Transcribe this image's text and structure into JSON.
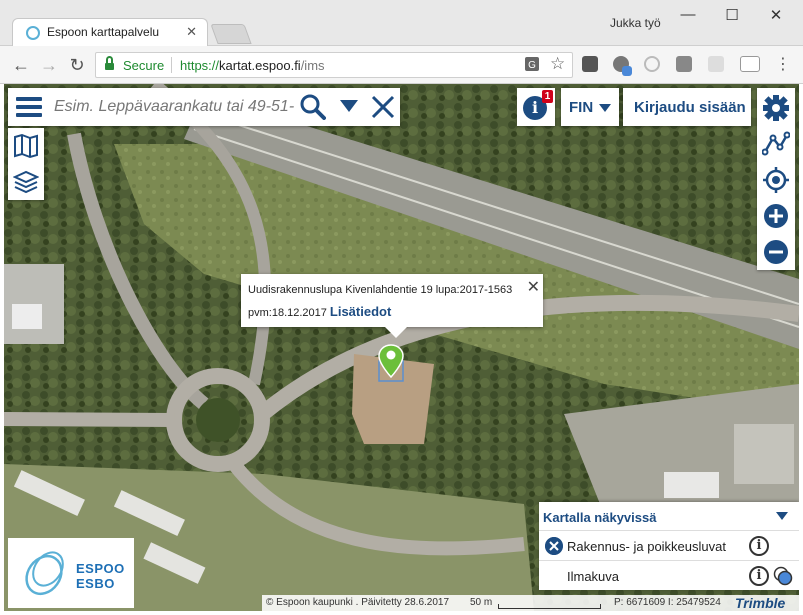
{
  "browser": {
    "tab_title": "Espoon karttapalvelu",
    "profile_name": "Jukka työ",
    "secure_label": "Secure",
    "url_scheme": "https://",
    "url_host": "kartat.espoo.fi",
    "url_path": "/ims"
  },
  "search": {
    "placeholder": "Esim. Leppävaarankatu tai 49-51-"
  },
  "header": {
    "info_badge_count": "1",
    "info_glyph": "i",
    "language": "FIN",
    "login_label": "Kirjaudu sisään"
  },
  "popup": {
    "line1": "Uudisrakennuslupa Kivenlahdentie 19 lupa:2017-1563",
    "line2": "pvm:18.12.2017",
    "link": "Lisätiedot",
    "close_glyph": "✕"
  },
  "logo": {
    "line1": "ESPOO",
    "line2": "ESBO"
  },
  "layers_panel": {
    "title": "Kartalla näkyvissä",
    "items": [
      {
        "name": "Rakennus- ja poikkeusluvat",
        "removable": true
      },
      {
        "name": "Ilmakuva",
        "removable": false
      }
    ]
  },
  "statusbar": {
    "copyright": "© Espoon kaupunki . Päivitetty 28.6.2017",
    "scale": "50 m",
    "coordinates": "P: 6671609 I: 25479524",
    "provider": "Trimble"
  },
  "icons": {
    "menu": "hamburger-icon",
    "search": "search-icon",
    "dropdown": "chevron-down-icon",
    "clear": "close-icon",
    "map_view": "map-icon",
    "layers": "layers-icon",
    "settings": "gear-icon",
    "measure": "measure-icon",
    "locate": "locate-icon",
    "zoom_in": "zoom-in-icon",
    "zoom_out": "zoom-out-icon",
    "marker": "map-marker-icon"
  },
  "colors": {
    "brand_blue": "#1d4c82",
    "logo_blue": "#1d6fb5",
    "marker_green": "#6cbf3a",
    "badge_red": "#d0021b"
  }
}
